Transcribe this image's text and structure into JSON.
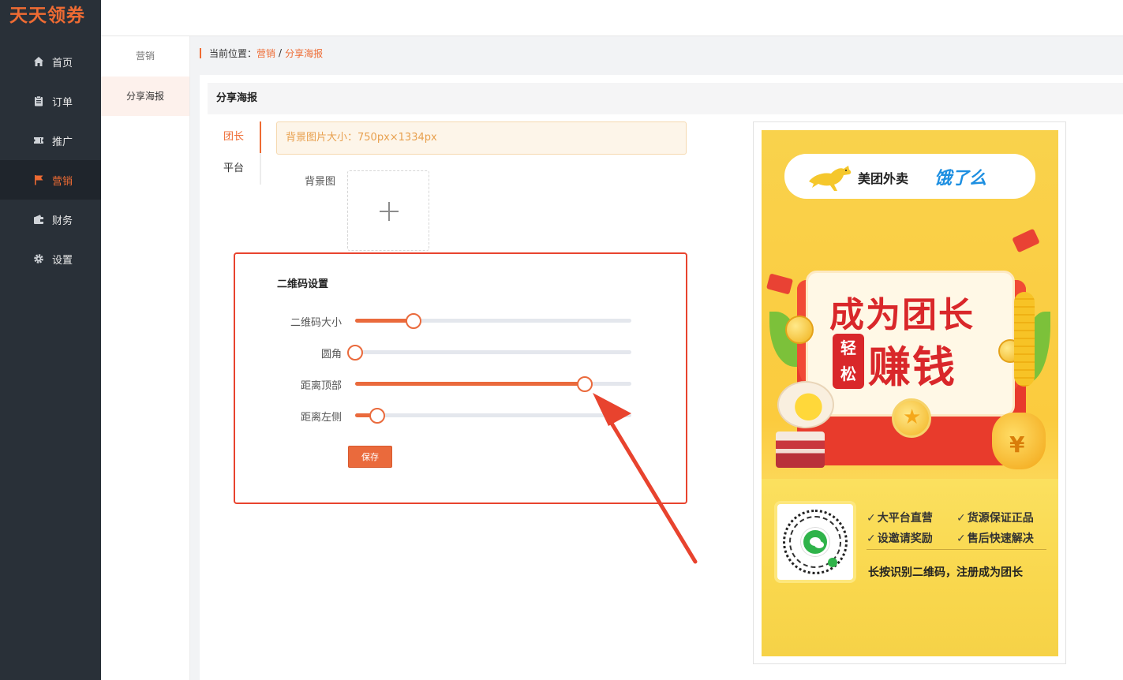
{
  "app": {
    "logo": "天天领券"
  },
  "sidebar": {
    "items": [
      {
        "label": "首页",
        "icon": "home-icon"
      },
      {
        "label": "订单",
        "icon": "clipboard-icon"
      },
      {
        "label": "推广",
        "icon": "ticket-icon"
      },
      {
        "label": "营销",
        "icon": "flag-icon",
        "active": true
      },
      {
        "label": "财务",
        "icon": "wallet-icon"
      },
      {
        "label": "设置",
        "icon": "gear-icon"
      }
    ]
  },
  "subnav": {
    "title": "营销",
    "items": [
      {
        "label": "分享海报",
        "active": true
      }
    ]
  },
  "breadcrumb": {
    "prefix": "当前位置：",
    "level1": "营销",
    "separator": "/",
    "level2": "分享海报"
  },
  "section": {
    "title": "分享海报"
  },
  "tabs": [
    {
      "label": "团长",
      "active": true
    },
    {
      "label": "平台"
    }
  ],
  "notice": {
    "text": "背景图片大小：750px×1334px"
  },
  "background": {
    "label": "背景图"
  },
  "qr_settings": {
    "title": "二维码设置",
    "sliders": [
      {
        "label": "二维码大小",
        "value": 0.21
      },
      {
        "label": "圆角",
        "value": 0.0
      },
      {
        "label": "距离顶部",
        "value": 0.83
      },
      {
        "label": "距离左侧",
        "value": 0.08
      }
    ],
    "save_label": "保存"
  },
  "poster": {
    "brand_meituan": "美团外卖",
    "brand_eleme": "饿了么",
    "headline1": "成为团长",
    "badge_line1": "轻",
    "badge_line2": "松",
    "headline2": "赚钱",
    "yen": "¥",
    "features": [
      "大平台直营",
      "货源保证正品",
      "设邀请奖励",
      "售后快速解决"
    ],
    "scan_text": "长按识别二维码，注册成为团长"
  },
  "colors": {
    "accent": "#ea6a3c",
    "sidebar_bg": "#293038",
    "highlight_border": "#e8432e"
  }
}
